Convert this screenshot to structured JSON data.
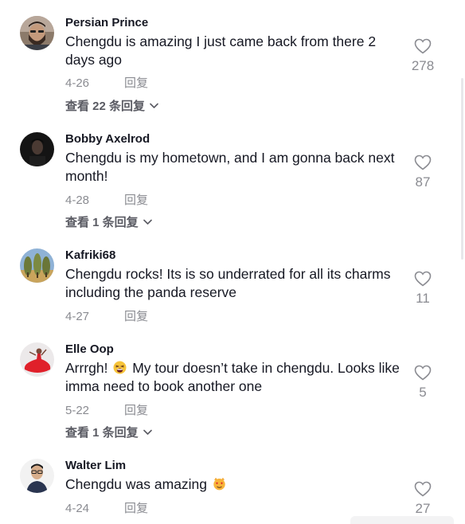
{
  "comments": [
    {
      "username": "Persian Prince",
      "text": "Chengdu is amazing I just came back from there 2 days ago",
      "date": "4-26",
      "reply_label": "回复",
      "view_replies": "查看 22 条回复",
      "likes": "278",
      "avatar": "bearded-man-avatar"
    },
    {
      "username": "Bobby Axelrod",
      "text": "Chengdu is my hometown, and I am gonna back next month!",
      "date": "4-28",
      "reply_label": "回复",
      "view_replies": "查看 1 条回复",
      "likes": "87",
      "avatar": "dark-portrait-avatar"
    },
    {
      "username": "Kafriki68",
      "text": "Chengdu rocks! Its is so underrated for all its charms including the panda reserve",
      "date": "4-27",
      "reply_label": "回复",
      "likes": "11",
      "avatar": "landscape-trees-avatar"
    },
    {
      "username": "Elle Oop",
      "text_before": "Arrrgh!",
      "emoji": "tired-face-emoji",
      "text_after": "My tour doesn’t take in chengdu. Looks like imma need to book another one",
      "date": "5-22",
      "reply_label": "回复",
      "view_replies": "查看 1 条回复",
      "likes": "5",
      "avatar": "red-dress-dancer-avatar"
    },
    {
      "username": "Walter Lim",
      "text": "Chengdu was amazing",
      "emoji": "heart-eyes-cat-emoji",
      "date": "4-24",
      "reply_label": "回复",
      "likes": "27",
      "avatar": "man-with-glasses-avatar"
    }
  ],
  "colors": {
    "username": "#161823",
    "body_text": "#161823",
    "meta": "#8a8b91",
    "view_replies": "#5a5b63"
  }
}
